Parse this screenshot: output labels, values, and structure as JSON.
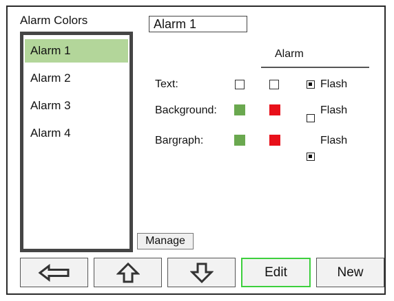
{
  "section_title": "Alarm Colors",
  "selected_name": "Alarm 1",
  "alarm_list": [
    {
      "label": "Alarm 1",
      "selected": true
    },
    {
      "label": "Alarm 2",
      "selected": false
    },
    {
      "label": "Alarm 3",
      "selected": false
    },
    {
      "label": "Alarm 4",
      "selected": false
    }
  ],
  "alarm_column_header": "Alarm",
  "rows": [
    {
      "label": "Text:",
      "normal_color": "none",
      "alarm_color": "none",
      "flash": true,
      "flash_label": "Flash"
    },
    {
      "label": "Background:",
      "normal_color": "#6aa84f",
      "alarm_color": "#e8101a",
      "flash": false,
      "flash_label": "Flash"
    },
    {
      "label": "Bargraph:",
      "normal_color": "#6aa84f",
      "alarm_color": "#e8101a",
      "flash": true,
      "flash_label": "Flash"
    }
  ],
  "manage_label": "Manage",
  "bottom_buttons": {
    "left_arrow_icon": "arrow-left-icon",
    "up_arrow_icon": "arrow-up-icon",
    "down_arrow_icon": "arrow-down-icon",
    "edit_label": "Edit",
    "new_label": "New"
  },
  "colors": {
    "selection": "#b3d69a",
    "green_swatch": "#6aa84f",
    "red_swatch": "#e8101a",
    "edit_border": "#3ccf3c"
  }
}
